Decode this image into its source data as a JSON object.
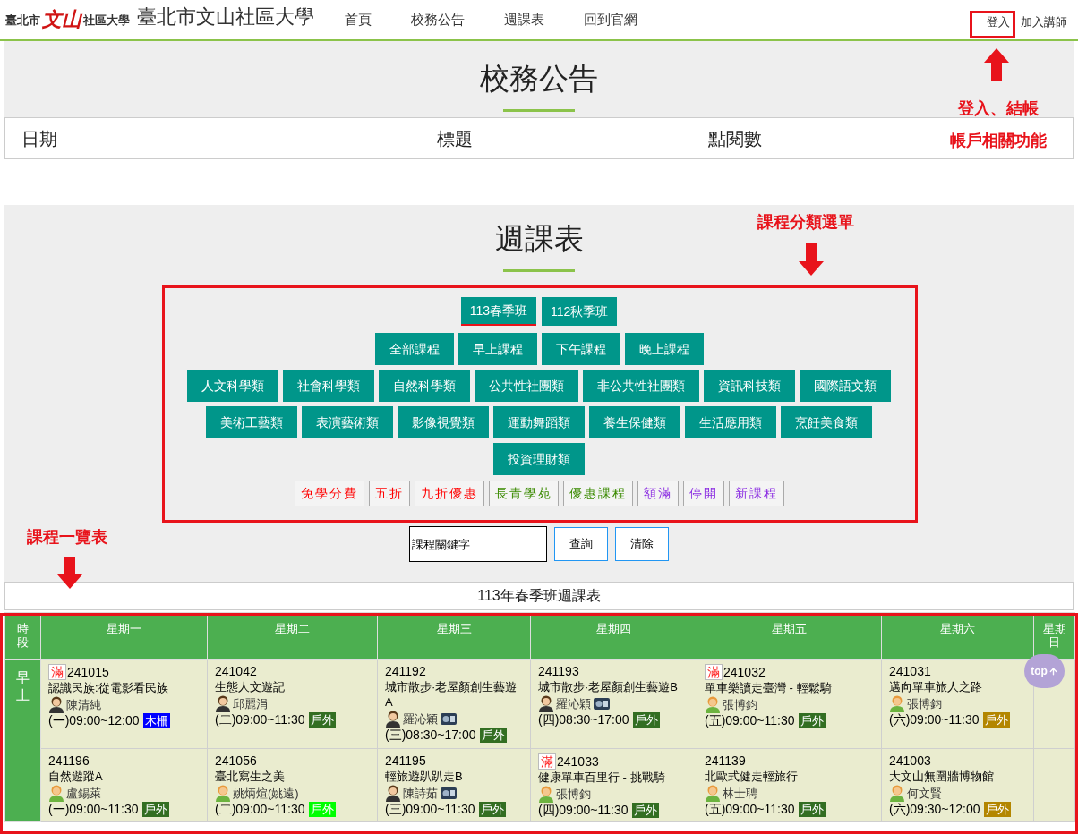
{
  "header": {
    "logo": {
      "left": "臺北市",
      "mark": "文山",
      "right": "社區大學"
    },
    "site_title": "臺北市文山社區大學",
    "nav": [
      "首頁",
      "校務公告",
      "週課表",
      "回到官網"
    ],
    "login": "登入",
    "join": "加入講師"
  },
  "announcements": {
    "title": "校務公告",
    "columns": [
      "日期",
      "標題",
      "點閱數"
    ]
  },
  "schedule": {
    "title": "週課表",
    "terms": [
      {
        "label": "113春季班",
        "selected": true
      },
      {
        "label": "112秋季班",
        "selected": false
      }
    ],
    "time_filters": [
      "全部課程",
      "早上課程",
      "下午課程",
      "晚上課程"
    ],
    "category_rows": [
      [
        "人文科學類",
        "社會科學類",
        "自然科學類",
        "公共性社團類",
        "非公共性社團類",
        "資訊科技類",
        "國際語文類"
      ],
      [
        "美術工藝類",
        "表演藝術類",
        "影像視覺類",
        "運動舞蹈類",
        "養生保健類",
        "生活應用類",
        "烹飪美食類"
      ],
      [
        "投資理財類"
      ]
    ],
    "tags": [
      {
        "label": "免學分費",
        "color": "#ff0000"
      },
      {
        "label": "五折",
        "color": "#ff0000"
      },
      {
        "label": "九折優惠",
        "color": "#ff0000"
      },
      {
        "label": "長青學苑",
        "color": "#3a8a00"
      },
      {
        "label": "優惠課程",
        "color": "#3a8a00"
      },
      {
        "label": "額滿",
        "color": "#8a2be2"
      },
      {
        "label": "停開",
        "color": "#8a2be2"
      },
      {
        "label": "新課程",
        "color": "#8a2be2"
      }
    ],
    "search": {
      "placeholder": "課程關鍵字",
      "buttons": [
        "查詢",
        "清除"
      ]
    }
  },
  "timetable": {
    "caption": "113年春季班週課表",
    "columns": [
      "時段",
      "星期一",
      "星期二",
      "星期三",
      "星期四",
      "星期五",
      "星期六",
      "星期日"
    ],
    "periods": [
      {
        "label": "早上",
        "rows": [
          [
            {
              "full": true,
              "badge": "滿",
              "code": "241015",
              "title": "認識民族:從電影看民族",
              "teacher": {
                "name": "陳清純",
                "kind": "female"
              },
              "video": false,
              "time": "(一)09:00~12:00",
              "tag": {
                "text": "木柵",
                "color": "#0000ff"
              }
            },
            {
              "full": false,
              "code": "241042",
              "title": "生態人文遊記",
              "teacher": {
                "name": "邱麗涓",
                "kind": "female"
              },
              "video": false,
              "time": "(二)09:00~11:30",
              "tag": {
                "text": "戶外",
                "color": "#336e22"
              }
            },
            {
              "full": false,
              "code": "241192",
              "title": "城市散步·老屋顏創生藝遊A",
              "teacher": {
                "name": "羅沁穎",
                "kind": "female"
              },
              "video": true,
              "time": "(三)08:30~17:00",
              "tag": {
                "text": "戶外",
                "color": "#336e22"
              }
            },
            {
              "full": false,
              "code": "241193",
              "title": "城市散步·老屋顏創生藝遊B",
              "teacher": {
                "name": "羅沁穎",
                "kind": "female"
              },
              "video": true,
              "time": "(四)08:30~17:00",
              "tag": {
                "text": "戶外",
                "color": "#336e22"
              }
            },
            {
              "full": true,
              "badge": "滿",
              "code": "241032",
              "title": "單車樂讀走臺灣 - 輕鬆騎",
              "teacher": {
                "name": "張博鈞",
                "kind": "male"
              },
              "video": false,
              "time": "(五)09:00~11:30",
              "tag": {
                "text": "戶外",
                "color": "#336e22"
              }
            },
            {
              "full": false,
              "code": "241031",
              "title": "邁向單車旅人之路",
              "teacher": {
                "name": "張博鈞",
                "kind": "male"
              },
              "video": false,
              "time": "(六)09:00~11:30",
              "tag": {
                "text": "戶外",
                "color": "#b38600"
              }
            }
          ],
          [
            {
              "full": false,
              "code": "241196",
              "title": "自然遊蹤A",
              "teacher": {
                "name": "盧錫萊",
                "kind": "male"
              },
              "video": false,
              "time": "(一)09:00~11:30",
              "tag": {
                "text": "戶外",
                "color": "#336e22"
              }
            },
            {
              "full": false,
              "code": "241056",
              "title": "臺北寫生之美",
              "teacher": {
                "name": "姚炳煊(姚遠)",
                "kind": "male"
              },
              "video": false,
              "time": "(二)09:00~11:30",
              "tag": {
                "text": "戶外",
                "color": "#00ff00"
              }
            },
            {
              "full": false,
              "code": "241195",
              "title": "輕旅遊趴趴走B",
              "teacher": {
                "name": "陳詩茹",
                "kind": "female"
              },
              "video": true,
              "time": "(三)09:00~11:30",
              "tag": {
                "text": "戶外",
                "color": "#336e22"
              }
            },
            {
              "full": true,
              "badge": "滿",
              "code": "241033",
              "title": "健康單車百里行 - 挑戰騎",
              "teacher": {
                "name": "張博鈞",
                "kind": "male"
              },
              "video": false,
              "time": "(四)09:00~11:30",
              "tag": {
                "text": "戶外",
                "color": "#336e22"
              }
            },
            {
              "full": false,
              "code": "241139",
              "title": "北歐式健走輕旅行",
              "teacher": {
                "name": "林士聘",
                "kind": "male"
              },
              "video": false,
              "time": "(五)09:00~11:30",
              "tag": {
                "text": "戶外",
                "color": "#336e22"
              }
            },
            {
              "full": false,
              "code": "241003",
              "title": "大文山無圍牆博物館",
              "teacher": {
                "name": "何文賢",
                "kind": "male"
              },
              "video": false,
              "time": "(六)09:30~12:00",
              "tag": {
                "text": "戶外",
                "color": "#b38600"
              }
            }
          ]
        ]
      }
    ]
  },
  "top_button": "top",
  "annotations": {
    "login_note": [
      "登入、結帳",
      "帳戶相關功能"
    ],
    "menu_note": "課程分類選單",
    "list_note": "課程一覽表"
  }
}
